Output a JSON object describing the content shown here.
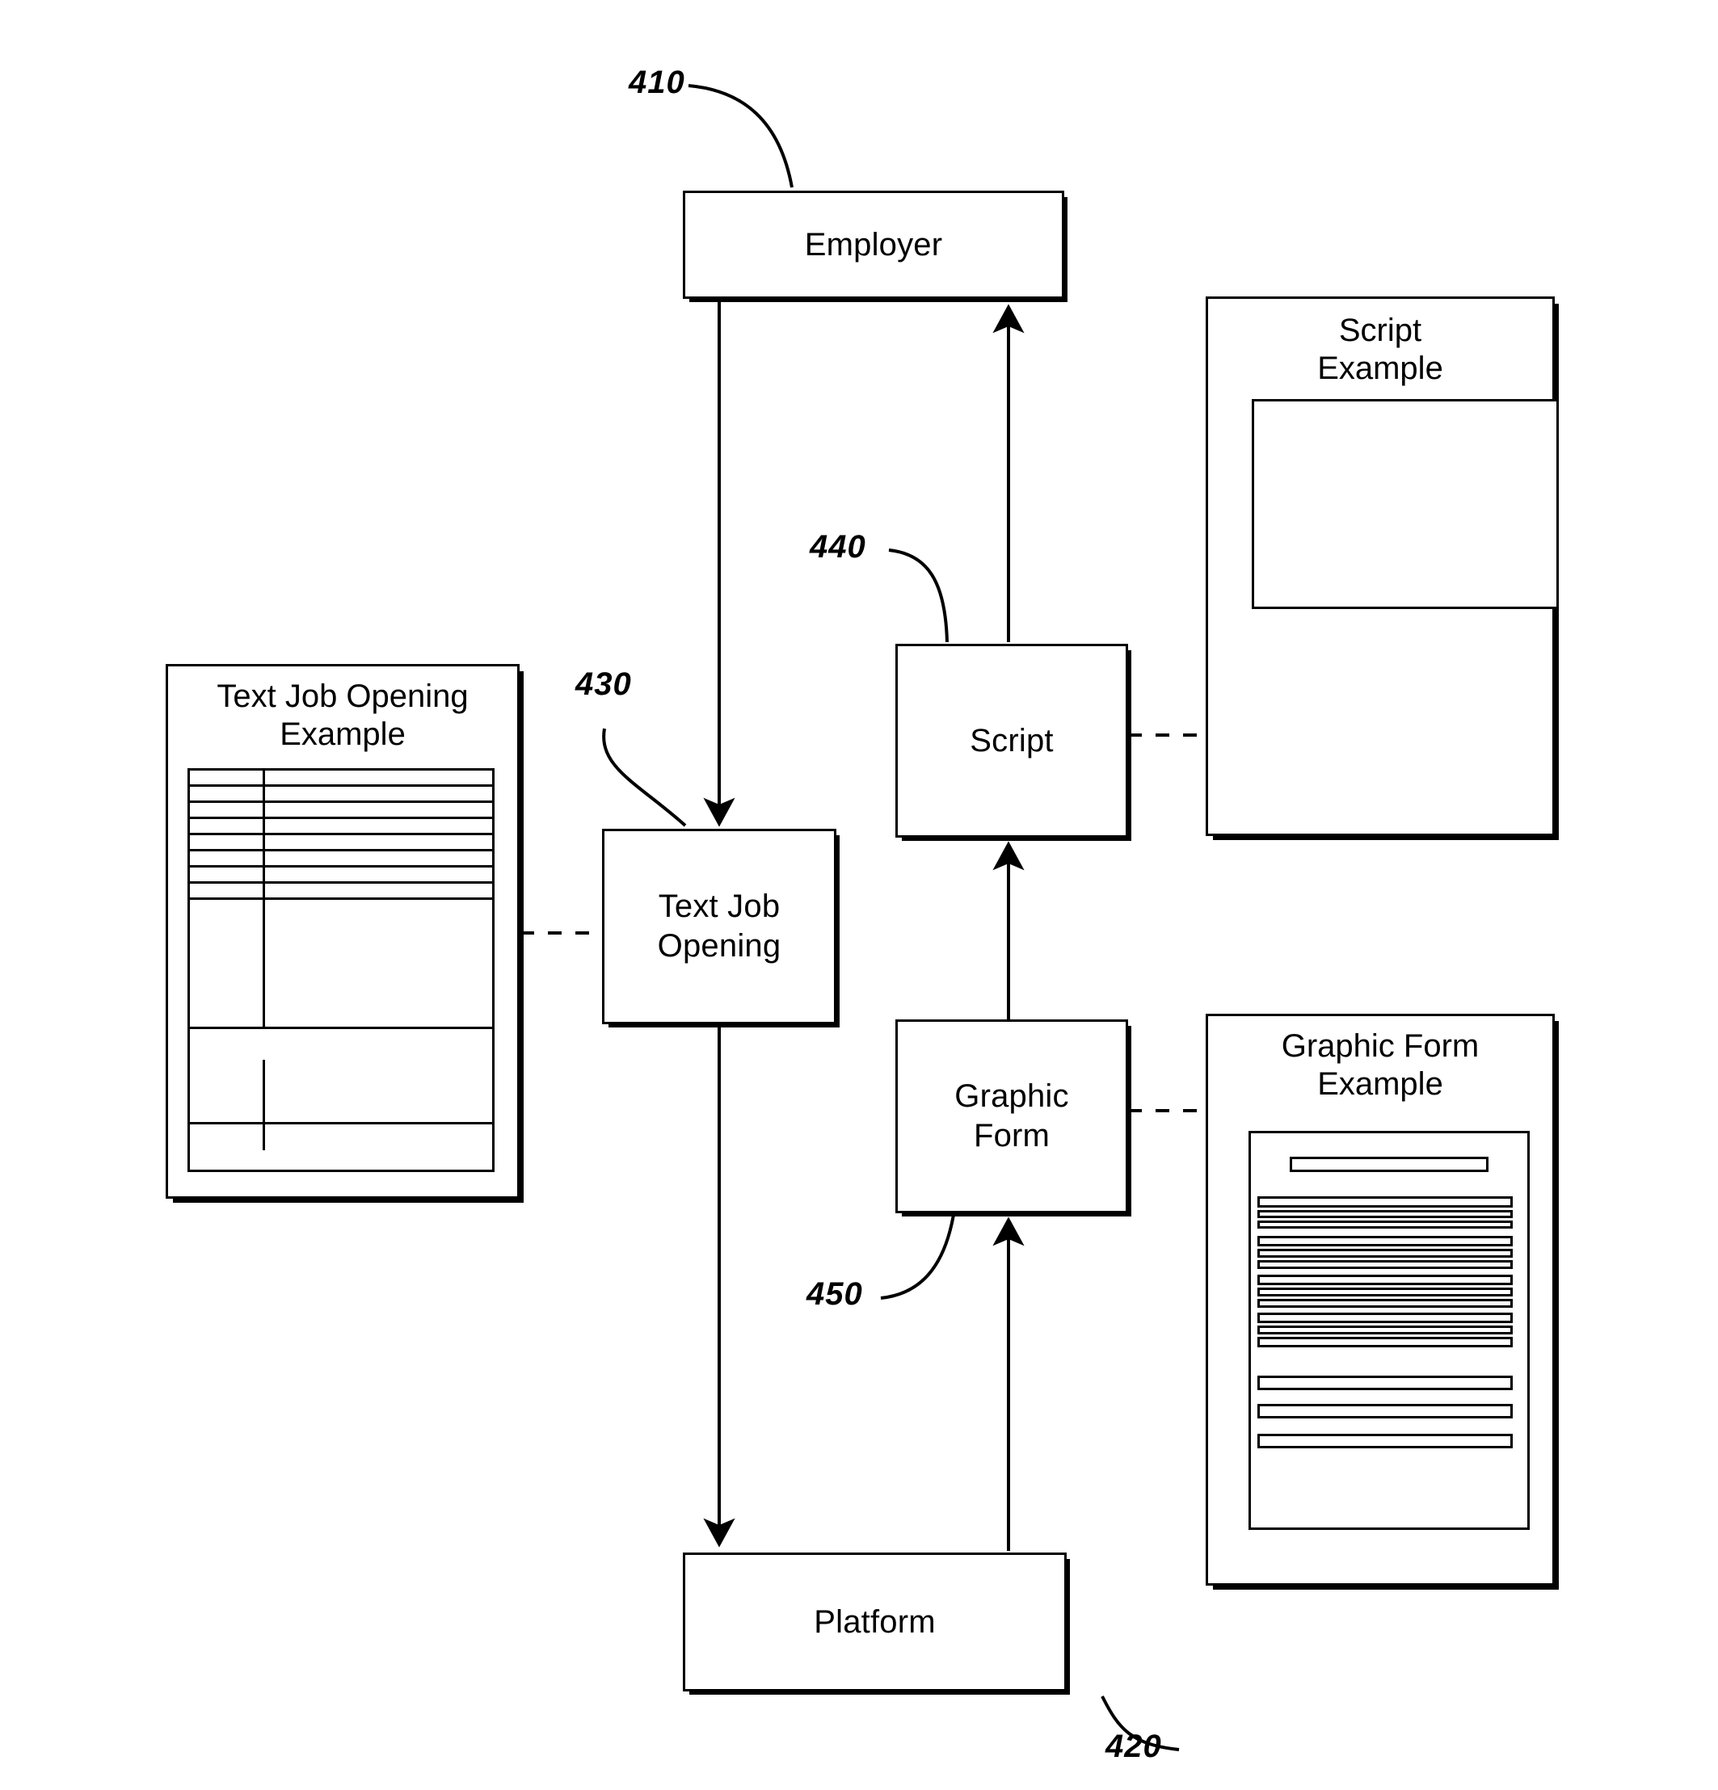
{
  "figure": {
    "kind": "patent-block-diagram",
    "ink_color": "#000000",
    "background_color": "#ffffff"
  },
  "nodes": {
    "employer": {
      "label": "Employer",
      "ref": "410"
    },
    "platform": {
      "label": "Platform",
      "ref": "420"
    },
    "text_job_opening": {
      "label": "Text Job\nOpening",
      "ref": "430"
    },
    "script": {
      "label": "Script",
      "ref": "440"
    },
    "graphic_form": {
      "label": "Graphic\nForm",
      "ref": "450"
    }
  },
  "panels": {
    "text_job_opening_example": {
      "title": "Text Job Opening\nExample"
    },
    "script_example": {
      "title": "Script\nExample"
    },
    "graphic_form_example": {
      "title": "Graphic Form\nExample"
    }
  },
  "ref_labels": [
    {
      "text": "410"
    },
    {
      "text": "420"
    },
    {
      "text": "430"
    },
    {
      "text": "440"
    },
    {
      "text": "450"
    }
  ],
  "connections": [
    {
      "from": "employer",
      "to": "text_job_opening",
      "style": "solid-arrow",
      "direction": "down"
    },
    {
      "from": "text_job_opening",
      "to": "platform",
      "style": "solid-arrow",
      "direction": "down"
    },
    {
      "from": "script",
      "to": "employer",
      "style": "solid-arrow",
      "direction": "up"
    },
    {
      "from": "graphic_form",
      "to": "script",
      "style": "solid-arrow",
      "direction": "up"
    },
    {
      "from": "platform",
      "to": "graphic_form",
      "style": "solid-arrow",
      "direction": "up"
    },
    {
      "from": "text_job_opening_example",
      "to": "text_job_opening",
      "style": "dashed-link"
    },
    {
      "from": "script",
      "to": "script_example",
      "style": "dashed-link"
    },
    {
      "from": "graphic_form",
      "to": "graphic_form_example",
      "style": "dashed-link"
    }
  ]
}
